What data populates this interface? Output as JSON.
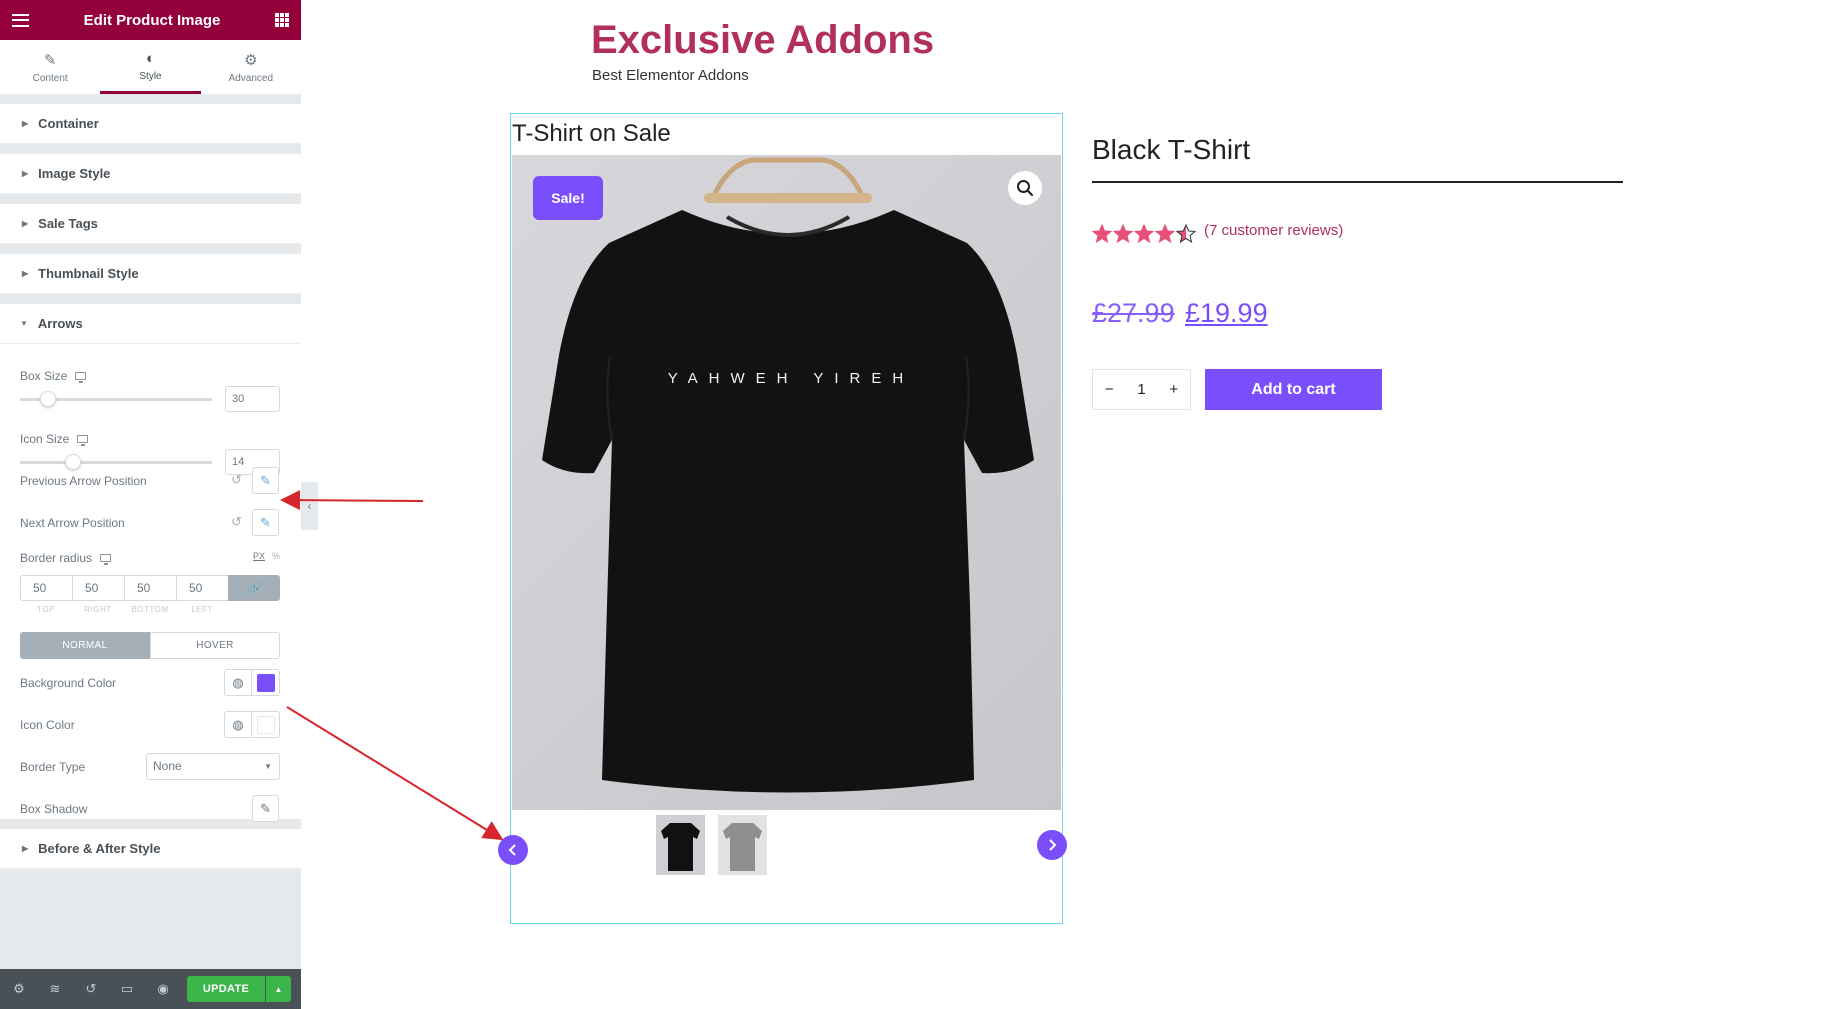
{
  "editor": {
    "title": "Edit Product Image",
    "tabs": [
      {
        "label": "Content",
        "icon": "pencil-icon"
      },
      {
        "label": "Style",
        "icon": "half-circle-icon"
      },
      {
        "label": "Advanced",
        "icon": "gear-icon"
      }
    ],
    "active_tab": "Style",
    "sections": [
      "Container",
      "Image Style",
      "Sale Tags",
      "Thumbnail Style"
    ],
    "arrows": {
      "title": "Arrows",
      "box_size_label": "Box Size",
      "box_size_value": "30",
      "icon_size_label": "Icon Size",
      "icon_size_value": "14",
      "prev_pos_label": "Previous Arrow Position",
      "next_pos_label": "Next Arrow Position",
      "border_radius_label": "Border radius",
      "unit_px": "PX",
      "unit_pct": "%",
      "radius": [
        {
          "value": "50",
          "side": "TOP"
        },
        {
          "value": "50",
          "side": "RIGHT"
        },
        {
          "value": "50",
          "side": "BOTTOM"
        },
        {
          "value": "50",
          "side": "LEFT"
        }
      ],
      "state_normal": "NORMAL",
      "state_hover": "HOVER",
      "bg_color_label": "Background Color",
      "bg_color": "#7b4efc",
      "icon_color_label": "Icon Color",
      "icon_color": "#ffffff",
      "border_type_label": "Border Type",
      "border_type_value": "None",
      "box_shadow_label": "Box Shadow"
    },
    "after_section": "Before & After Style",
    "update_label": "UPDATE"
  },
  "site": {
    "title": "Exclusive Addons",
    "tagline": "Best Elementor Addons"
  },
  "widget": {
    "title": "T-Shirt on Sale",
    "sale_badge": "Sale!",
    "shirt_print": "YAHWEH YIREH"
  },
  "product": {
    "name": "Black T-Shirt",
    "rating": 4.5,
    "reviews": "(7 customer reviews)",
    "old_price": "£27.99",
    "new_price": "£19.99",
    "qty_minus": "−",
    "quantity": "1",
    "qty_plus": "+",
    "add_to_cart": "Add to cart"
  },
  "colors": {
    "accent": "#7b4efc",
    "brand": "#b02f5f",
    "editor_header": "#93003c",
    "update": "#39b54a"
  }
}
